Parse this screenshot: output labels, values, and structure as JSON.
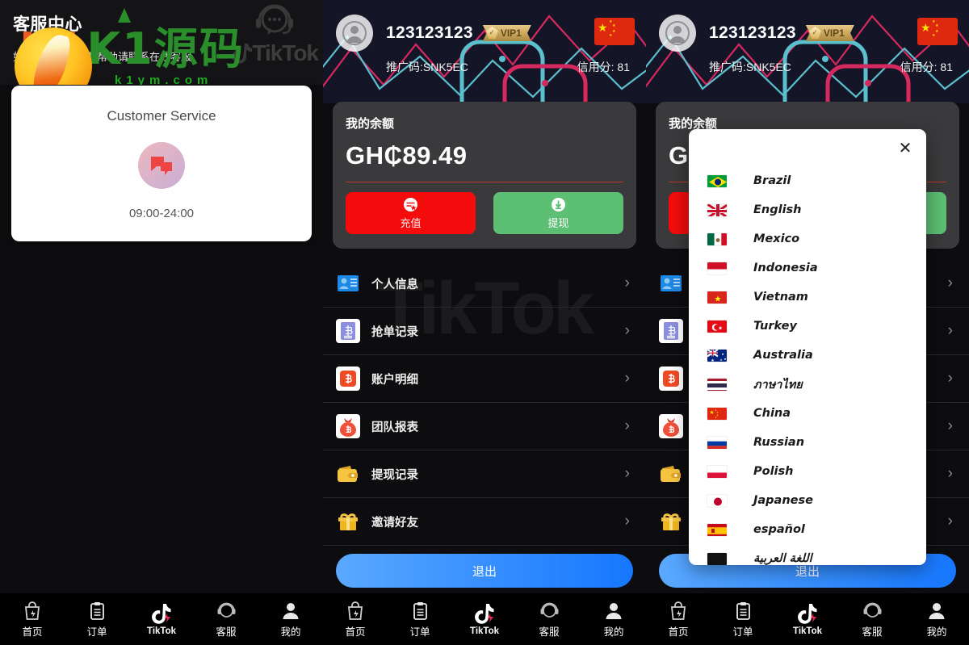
{
  "left_panel": {
    "header": {
      "title": "客服中心",
      "subtitle": "如果您有任何需要帮助请联系在线客服",
      "brand": "TikTok"
    },
    "watermark": {
      "cn": "K1源码",
      "domain": "k1ym.com"
    },
    "card": {
      "title": "Customer Service",
      "icon": "chat-bubbles-icon",
      "hours": "09:00-24:00"
    }
  },
  "profile": {
    "user_id": "123123123",
    "vip_label": "VIP1",
    "promo_code_label": "推广码:SNK5EC",
    "credit_label": "信用分: 81",
    "flag": "china-flag",
    "balance": {
      "label": "我的余额",
      "amount": "GH₵89.49",
      "recharge_label": "充值",
      "withdraw_label": "提现",
      "recharge_color": "#f40c0c",
      "withdraw_color": "#5cbf73"
    },
    "menu": [
      {
        "label": "个人信息",
        "icon": "id-card-icon",
        "glyph": "👤",
        "bg": "#ffffff"
      },
      {
        "label": "抢单记录",
        "icon": "order-record-icon",
        "glyph": "฿",
        "bg": "#ffffff"
      },
      {
        "label": "账户明细",
        "icon": "account-detail-icon",
        "glyph": "฿",
        "bg": "#ffffff"
      },
      {
        "label": "团队报表",
        "icon": "team-report-icon",
        "glyph": "฿",
        "bg": "#ffffff"
      },
      {
        "label": "提现记录",
        "icon": "wallet-icon",
        "glyph": "👛",
        "bg": "#ffffff"
      },
      {
        "label": "邀请好友",
        "icon": "gift-icon",
        "glyph": "🎁",
        "bg": "#ffffff"
      }
    ],
    "logout_label": "退出",
    "chevron": "›",
    "bg_watermark": "TikTok"
  },
  "tabbar": [
    {
      "label": "首页",
      "icon": "home-bag-icon"
    },
    {
      "label": "订单",
      "icon": "clipboard-icon"
    },
    {
      "label": "TikTok",
      "icon": "tiktok-note-icon"
    },
    {
      "label": "客服",
      "icon": "headset-icon"
    },
    {
      "label": "我的",
      "icon": "person-icon"
    }
  ],
  "language_modal": {
    "close_icon": "close-icon",
    "items": [
      {
        "name": "Brazil",
        "flag": "brazil-flag"
      },
      {
        "name": "English",
        "flag": "uk-flag"
      },
      {
        "name": "Mexico",
        "flag": "mexico-flag"
      },
      {
        "name": "Indonesia",
        "flag": "indonesia-flag"
      },
      {
        "name": "Vietnam",
        "flag": "vietnam-flag"
      },
      {
        "name": "Turkey",
        "flag": "turkey-flag"
      },
      {
        "name": "Australia",
        "flag": "australia-flag"
      },
      {
        "name": "ภาษาไทย",
        "flag": "thailand-flag"
      },
      {
        "name": "China",
        "flag": "china-flag"
      },
      {
        "name": "Russian",
        "flag": "russia-flag"
      },
      {
        "name": "Polish",
        "flag": "poland-flag"
      },
      {
        "name": "Japanese",
        "flag": "japan-flag"
      },
      {
        "name": "español",
        "flag": "spain-flag"
      },
      {
        "name": "اللغة العربية",
        "flag": "arabic-flag"
      }
    ]
  }
}
